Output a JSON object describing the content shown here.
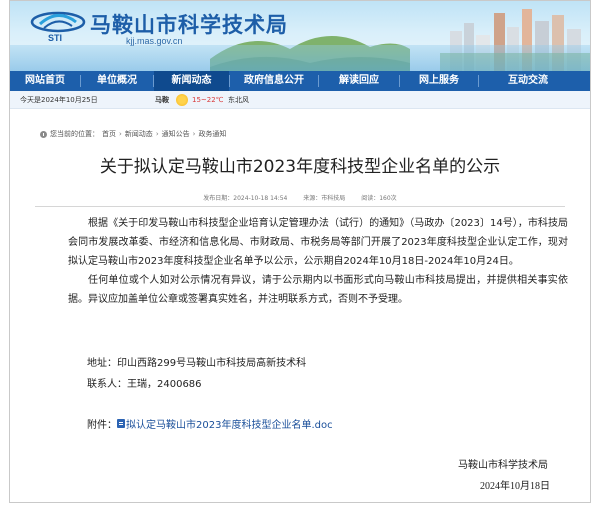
{
  "header": {
    "site_title": "马鞍山市科学技术局",
    "logo_text": "STI",
    "url": "kjj.mas.gov.cn"
  },
  "nav": {
    "items": [
      "网站首页",
      "单位概况",
      "新闻动态",
      "政府信息公开",
      "解读回应",
      "网上服务",
      "互动交流"
    ],
    "active_index": 2
  },
  "info_bar": {
    "date": "今天是2024年10月25日",
    "city": "马鞍",
    "weather_icon": "sun-icon",
    "temperature": "15~22℃",
    "wind": "东北风"
  },
  "breadcrumb": {
    "prefix": "您当前的位置：",
    "items": [
      "首页",
      "新闻动态",
      "通知公告",
      "政务通知"
    ]
  },
  "article": {
    "title": "关于拟认定马鞍山市2023年度科技型企业名单的公示",
    "publish_time": "发布日期：2024-10-18 14:54",
    "source": "来源：市科技局",
    "views": "阅读：160次",
    "paragraphs": [
      "根据《关于印发马鞍山市科技型企业培育认定管理办法（试行）的通知》（马政办〔2023〕14号），市科技局会同市发展改革委、市经济和信息化局、市财政局、市税务局等部门开展了2023年度科技型企业认定工作，现对拟认定马鞍山市2023年度科技型企业名单予以公示，公示期自2024年10月18日-2024年10月24日。",
      "任何单位或个人如对公示情况有异议，请于公示期内以书面形式向马鞍山市科技局提出，并提供相关事实依据。异议应加盖单位公章或签署真实姓名，并注明联系方式，否则不予受理。"
    ],
    "address": "地址：印山西路299号马鞍山市科技局高新技术科",
    "contact": "联系人：王瑞，2400686",
    "attachment_label": "附件：",
    "attachment_link": "拟认定马鞍山市2023年度科技型企业名单.doc",
    "signature_org": "马鞍山市科学技术局",
    "signature_date": "2024年10月18日"
  },
  "colors": {
    "nav_bg": "#1d5fab",
    "title_blue": "#1d5ea8",
    "temp_red": "#d93a3a"
  }
}
